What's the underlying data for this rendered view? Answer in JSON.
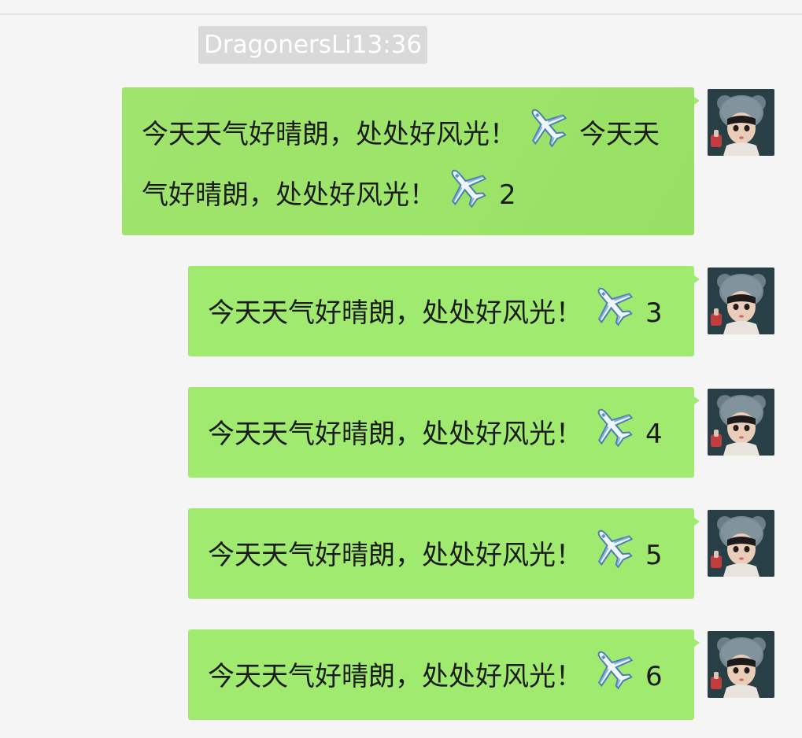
{
  "chat": {
    "sender_stamp": "DragonersLi13:36",
    "messages": [
      {
        "id": 1,
        "line1_text": "今天天气好晴朗，处处好风光！",
        "line1_after": "今天天",
        "line2_text": "气好晴朗，处处好风光！",
        "line2_after": "2",
        "icons": [
          "airplane-emoji-icon",
          "airplane-emoji-icon"
        ]
      },
      {
        "id": 3,
        "text": "今天天气好晴朗，处处好风光！",
        "suffix": "3",
        "icon": "airplane-emoji-icon"
      },
      {
        "id": 4,
        "text": "今天天气好晴朗，处处好风光！",
        "suffix": "4",
        "icon": "airplane-emoji-icon"
      },
      {
        "id": 5,
        "text": "今天天气好晴朗，处处好风光！",
        "suffix": "5",
        "icon": "airplane-emoji-icon"
      },
      {
        "id": 6,
        "text": "今天天气好晴朗，处处好风光！",
        "suffix": "6",
        "icon": "airplane-emoji-icon"
      }
    ],
    "avatar_icon": "doll-avatar-icon"
  },
  "colors": {
    "background": "#f5f5f5",
    "bubble": "#a0ea6f",
    "stamp_bg": "#d9d9d9",
    "stamp_text": "#ffffff",
    "message_text": "#1c1c1c"
  }
}
